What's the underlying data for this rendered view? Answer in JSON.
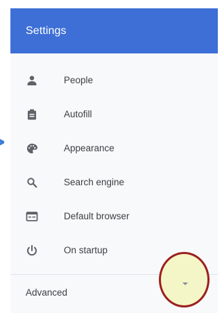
{
  "app": {
    "title": "Settings"
  },
  "sidebar": {
    "items": [
      {
        "label": "People",
        "icon": "person-icon"
      },
      {
        "label": "Autofill",
        "icon": "clipboard-icon"
      },
      {
        "label": "Appearance",
        "icon": "palette-icon"
      },
      {
        "label": "Search engine",
        "icon": "search-icon"
      },
      {
        "label": "Default browser",
        "icon": "browser-icon"
      },
      {
        "label": "On startup",
        "icon": "power-icon"
      }
    ],
    "advanced_label": "Advanced",
    "advanced_icon": "chevron-down-icon"
  },
  "annotations": {
    "highlight_color": "#9d1f1f",
    "highlight_fill": "#f4f6c7",
    "arrow_color": "#3d7fd6"
  },
  "colors": {
    "header": "#3d6fd6",
    "sidebar_bg": "#f8f9fa",
    "text": "#3c4043",
    "icon": "#5f6368"
  }
}
